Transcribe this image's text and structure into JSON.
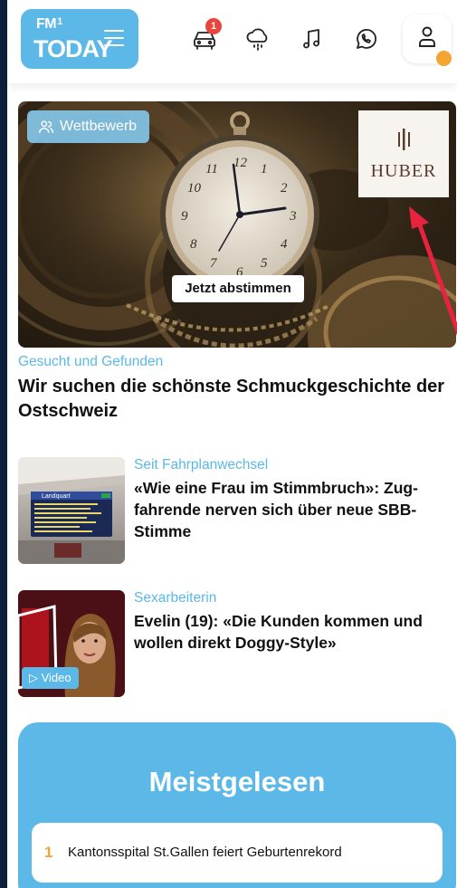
{
  "header": {
    "logo_fm": "FM",
    "logo_one": "1",
    "logo_today": "TODAY",
    "notification_count": "1",
    "icons": [
      "car-icon",
      "cloud-rain-icon",
      "music-icon",
      "whatsapp-icon",
      "user-icon"
    ],
    "accent": "#5cb8e6",
    "status_dot_color": "#f3a431"
  },
  "hero": {
    "tag": "Wettbewerb",
    "sponsor": "HUBER",
    "cta": "Jetzt abstimmen",
    "kicker": "Gesucht und Gefunden",
    "title": "Wir suchen die schönste Schmuckgeschichte der Ostschweiz"
  },
  "articles": [
    {
      "kicker": "Seit Fahrplanwechsel",
      "title": "«Wie eine Frau im Stimmbruch»: Zug­fahrende nerven sich über neue SBB-Stimme",
      "board_text": "Landquart"
    },
    {
      "kicker": "Sexarbeiterin",
      "title": "Evelin (19): «Die Kunden kommen und wollen direkt Doggy-Style»",
      "video_label": "Video"
    }
  ],
  "most_read": {
    "title": "Meistgelesen",
    "items": [
      {
        "rank": "1",
        "title": "Kantonsspital St.Gallen feiert Geburtenrekord"
      }
    ]
  }
}
